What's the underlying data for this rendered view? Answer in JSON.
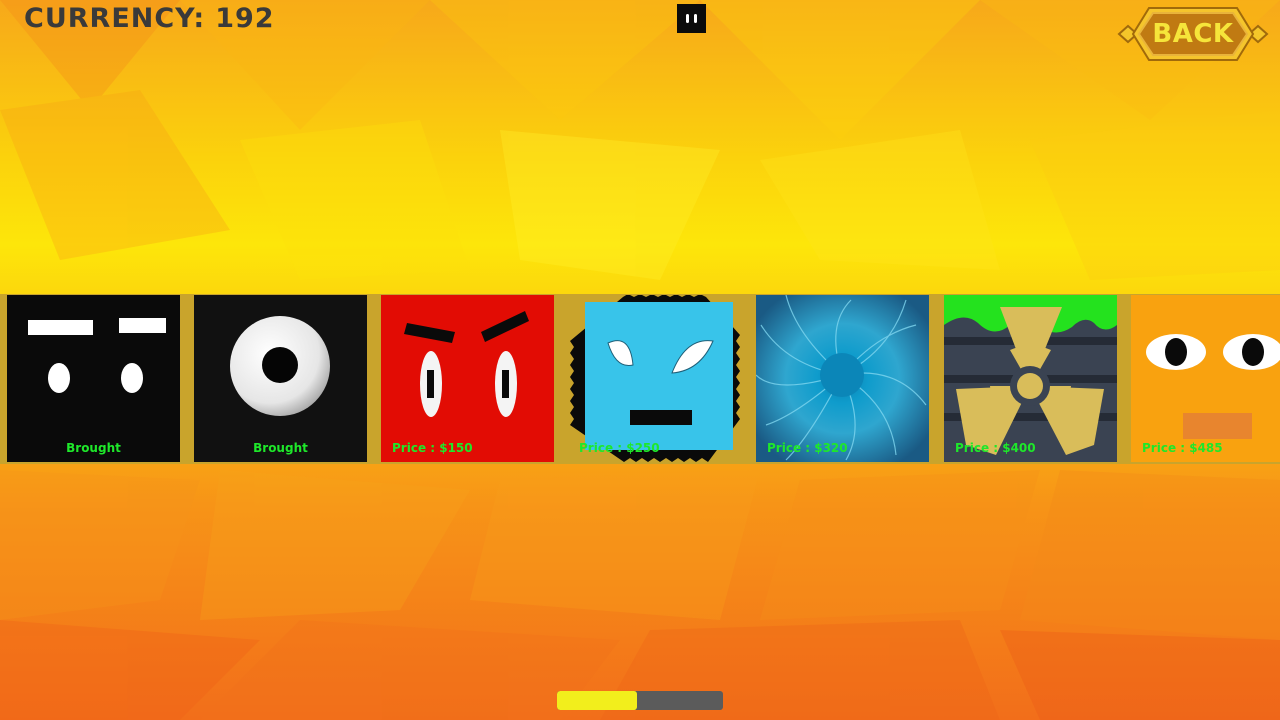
{
  "hud": {
    "currency_label": "CURRENCY:",
    "currency_value": "192",
    "back_label": "BACK"
  },
  "shop": {
    "items": [
      {
        "name": "black-plain",
        "status": "Brought",
        "colors": {
          "bg": "#0a0a0a"
        }
      },
      {
        "name": "black-cyclops",
        "status": "Brought",
        "colors": {
          "bg": "#111111"
        }
      },
      {
        "name": "red-angry",
        "status": "Price : $150",
        "colors": {
          "bg": "#e20c04"
        }
      },
      {
        "name": "blue-spiky",
        "status": "Price : $250",
        "colors": {
          "bg": "#38c4ea"
        }
      },
      {
        "name": "blue-vortex",
        "status": "Price : $320",
        "colors": {
          "bg": "#1c6f9a"
        }
      },
      {
        "name": "toxic-barrel",
        "status": "Price : $400",
        "colors": {
          "bg": "#3a4352"
        }
      },
      {
        "name": "orange-eyes",
        "status": "Price : $485",
        "colors": {
          "bg": "#f9a20f"
        }
      }
    ]
  },
  "scrollbar": {
    "position_fraction": 0.48
  },
  "colors": {
    "price_text": "#1ee82a",
    "strip": "#c9a42c",
    "back_text": "#f6e53a",
    "scroll_thumb": "#f2ee1c",
    "scroll_track": "#5b5b5b"
  }
}
